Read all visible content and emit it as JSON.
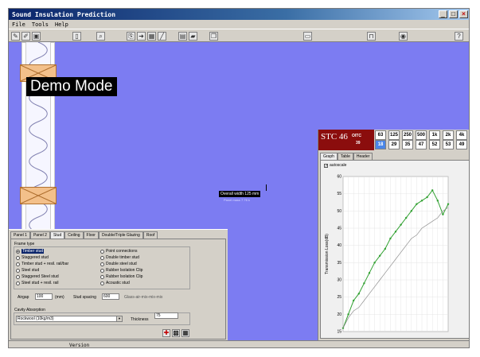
{
  "window": {
    "title": "Sound Insulation Prediction"
  },
  "menu": [
    "File",
    "Tools",
    "Help"
  ],
  "canvas": {
    "demo_label": "Demo Mode",
    "overall_width_label": "Overall width 125 mm",
    "mass_label": "Panel mass 7.76 k"
  },
  "panel": {
    "tabs": [
      "Panel 1",
      "Panel 2",
      "Stud",
      "Ceiling",
      "Floor",
      "Double/Triple Glazing",
      "Roof"
    ],
    "active_tab": 2,
    "frame_type_label": "Frame type",
    "frame_options_left": [
      "Timber stud",
      "Staggered stud",
      "Timber stud + resil. rail/bar",
      "Steel stud",
      "Staggered Steel stud",
      "Steel stud + resil. rail"
    ],
    "frame_options_right": [
      "Point connections",
      "Double timber stud",
      "Double steel stud",
      "Rubber Isolation Clip",
      "Rubber Isolation Clip",
      "Acoustic stud"
    ],
    "selected_option": "Timber stud",
    "airgap_label": "Airgap",
    "airgap_value": "100",
    "airgap_unit": "(mm)",
    "stud_spacing_label": "Stud spacing",
    "stud_spacing_value": "600",
    "extra_label": "Glass-air-mix-mix-mix",
    "cavity_label": "Cavity Absorption",
    "cavity_value": "Rockwool (10kg/m3)",
    "thickness_label": "Thickness",
    "thickness_value": "75"
  },
  "results": {
    "stc_label": "STC 46",
    "oitc_label": "OITC",
    "oitc_value": "39",
    "freq_headers": [
      "63",
      "125",
      "250",
      "500",
      "1k",
      "2k",
      "4k"
    ],
    "freq_values": [
      "18",
      "29",
      "35",
      "47",
      "52",
      "53",
      "49"
    ],
    "tabs": [
      "Graph",
      "Table",
      "Header"
    ],
    "autoscale_label": "autoscale"
  },
  "chart_data": {
    "type": "line",
    "ylabel": "Transmission Loss(dB)",
    "yticks": [
      15,
      20,
      25,
      30,
      35,
      40,
      45,
      50,
      55,
      60
    ],
    "ylim": [
      15,
      60
    ],
    "series": [
      {
        "values": [
          16,
          20,
          24,
          26,
          29,
          32,
          35,
          37,
          39,
          42,
          44,
          46,
          48,
          50,
          52,
          53,
          54,
          56,
          53,
          49,
          52
        ]
      },
      {
        "values": [
          16,
          19,
          21,
          22,
          24,
          26,
          28,
          30,
          32,
          34,
          36,
          38,
          40,
          42,
          43,
          45,
          46,
          47,
          48,
          50,
          51
        ]
      }
    ],
    "colors": [
      "#30a030",
      "#909090"
    ]
  },
  "status": {
    "text": "Version"
  }
}
